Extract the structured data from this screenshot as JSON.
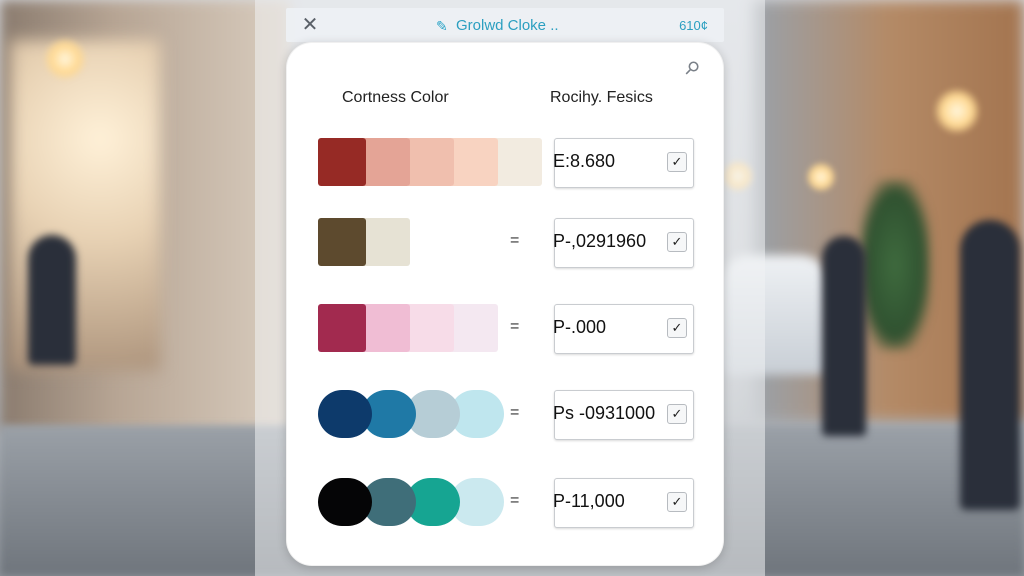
{
  "titlebar": {
    "close_glyph": "✕",
    "app_icon": "paint-drop-icon",
    "title": "Grolwd Cloke ..",
    "right_text": "610¢"
  },
  "panel": {
    "pin_icon": "pin-icon",
    "left_header": "Cortness Color",
    "right_header": "Rocihy. Fesics"
  },
  "rows": [
    {
      "shape": "square",
      "colors": [
        "#962a25",
        "#e4a496",
        "#f0bfae",
        "#f8d3c1",
        "#f2ebe0"
      ],
      "equals": "=",
      "value": "E:8.680",
      "checked": true
    },
    {
      "shape": "square",
      "colors": [
        "#5d4a2e",
        "#e6e2d4"
      ],
      "equals": "=",
      "value": "P-,0291960",
      "checked": true
    },
    {
      "shape": "square",
      "colors": [
        "#a22a4f",
        "#f0bdd4",
        "#f7dce8",
        "#f4e8f1"
      ],
      "equals": "=",
      "value": "P-.000",
      "checked": true
    },
    {
      "shape": "round",
      "colors": [
        "#0d3a6b",
        "#1f79a6",
        "#b6cdd6",
        "#bfe6ee"
      ],
      "equals": "=",
      "value": "Ps -0931000",
      "checked": true
    },
    {
      "shape": "round",
      "colors": [
        "#050506",
        "#3f6e79",
        "#16a592",
        "#cbe9ef"
      ],
      "equals": "=",
      "value": "P-11,000",
      "checked": true
    }
  ],
  "check_glyph": "✓"
}
